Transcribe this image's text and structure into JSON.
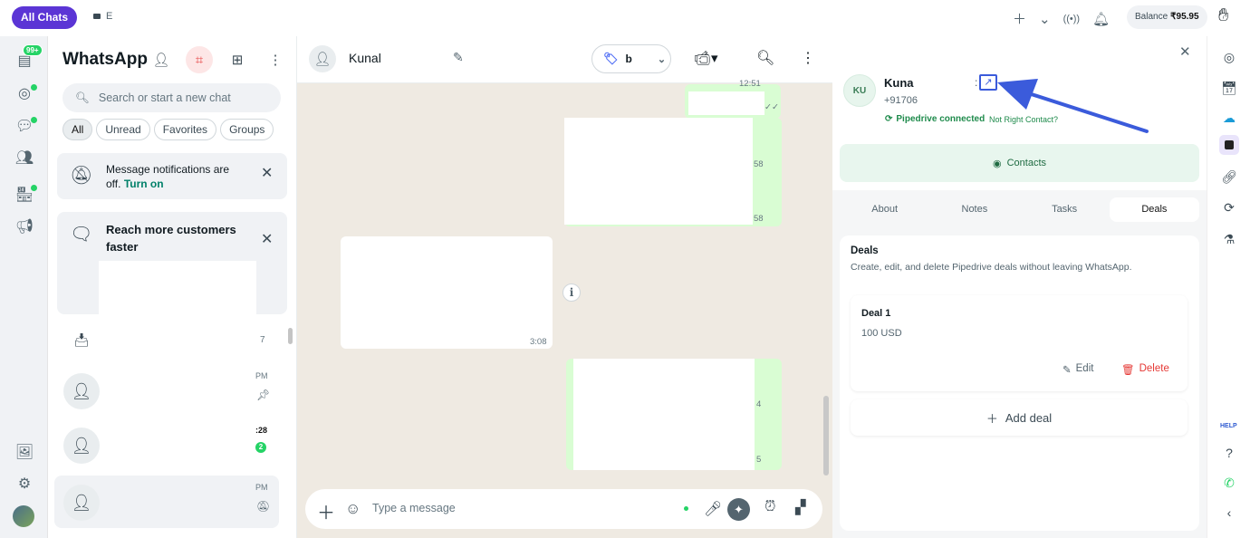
{
  "topbar": {
    "all_chats": "All Chats",
    "tab_e": "E",
    "balance_label": "Balance",
    "balance_value": "₹95.95"
  },
  "rail": {
    "badge": "99+"
  },
  "chatlist": {
    "title": "WhatsApp",
    "search_placeholder": "Search or start a new chat",
    "filters": [
      "All",
      "Unread",
      "Favorites",
      "Groups"
    ],
    "notif_text": "Message notifications are off.",
    "notif_link": "Turn on",
    "reach_title": "Reach more customers faster",
    "archived_count": "7",
    "rows": [
      {
        "time": "PM",
        "sub": "⊼"
      },
      {
        "time": ":28",
        "count": "2"
      },
      {
        "time": "PM",
        "sub": "🔕"
      }
    ]
  },
  "conversation": {
    "contact_name": "Kunal",
    "label_value": "b",
    "message_placeholder": "Type a message",
    "timestamps": [
      "12:51",
      "58",
      "58",
      "3:08",
      "4",
      "5"
    ],
    "info_glyph": "i"
  },
  "panel": {
    "initials": "KU",
    "name": "Kuna",
    "colon": ":",
    "phone": "+91706",
    "connected": "Pipedrive connected",
    "not_right": "Not Right Contact?",
    "contacts_btn": "Contacts",
    "tabs": [
      "About",
      "Notes",
      "Tasks",
      "Deals"
    ],
    "active_tab": "Deals",
    "deals_heading": "Deals",
    "deals_sub": "Create, edit, and delete Pipedrive deals without leaving WhatsApp.",
    "deal_name": "Deal 1",
    "deal_value": "100 USD",
    "edit": "Edit",
    "delete": "Delete",
    "add_deal": "Add deal"
  },
  "right_rail": {
    "help": "HELP"
  },
  "colors": {
    "accent": "#5b35d5",
    "whatsapp_green": "#25d366",
    "annotation_arrow": "#3b5bdb",
    "delete_red": "#e53935"
  }
}
